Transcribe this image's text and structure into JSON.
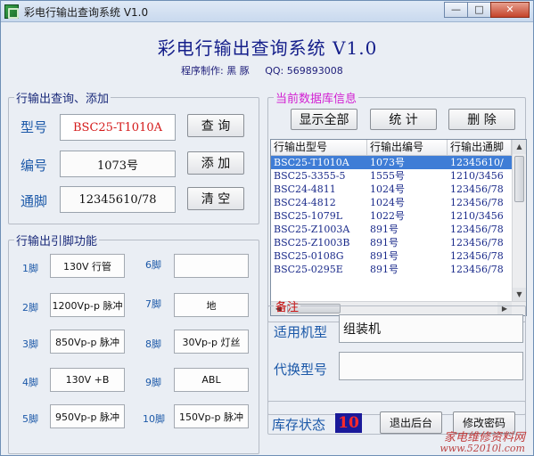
{
  "window": {
    "title": "彩电行输出查询系统 V1.0"
  },
  "header": {
    "title": "彩电行输出查询系统 V1.0",
    "author": "程序制作: 黑 豚",
    "qq": "QQ: 569893008"
  },
  "query": {
    "legend": "行输出查询、添加",
    "model_label": "型号",
    "model_value": "BSC25-T1010A",
    "code_label": "编号",
    "code_value": "1073号",
    "pins_label": "通脚",
    "pins_value": "12345610/78",
    "btn_query": "查 询",
    "btn_add": "添 加",
    "btn_clear": "清 空"
  },
  "pin_functions": {
    "legend": "行输出引脚功能",
    "pins": [
      {
        "label": "1脚",
        "value": "130V 行管"
      },
      {
        "label": "2脚",
        "value": "1200Vp-p 脉冲"
      },
      {
        "label": "3脚",
        "value": "850Vp-p 脉冲"
      },
      {
        "label": "4脚",
        "value": "130V +B"
      },
      {
        "label": "5脚",
        "value": "950Vp-p 脉冲"
      },
      {
        "label": "6脚",
        "value": ""
      },
      {
        "label": "7脚",
        "value": "地"
      },
      {
        "label": "8脚",
        "value": "30Vp-p 灯丝"
      },
      {
        "label": "9脚",
        "value": "ABL"
      },
      {
        "label": "10脚",
        "value": "150Vp-p 脉冲"
      }
    ]
  },
  "database": {
    "legend": "当前数据库信息",
    "btn_show_all": "显示全部",
    "btn_stats": "统  计",
    "btn_delete": "删  除",
    "columns": [
      "行输出型号",
      "行输出编号",
      "行输出通脚"
    ],
    "rows": [
      [
        "BSC25-T1010A",
        "1073号",
        "12345610/"
      ],
      [
        "BSC25-3355-5",
        "1555号",
        "1210/3456"
      ],
      [
        "BSC24-4811",
        "1024号",
        "123456/78"
      ],
      [
        "BSC24-4812",
        "1024号",
        "123456/78"
      ],
      [
        "BSC25-1079L",
        "1022号",
        "1210/3456"
      ],
      [
        "BSC25-Z1003A",
        "891号",
        "123456/78"
      ],
      [
        "BSC25-Z1003B",
        "891号",
        "123456/78"
      ],
      [
        "BSC25-0108G",
        "891号",
        "123456/78"
      ],
      [
        "BSC25-0295E",
        "891号",
        "123456/78"
      ]
    ],
    "selected_row": 0
  },
  "notes": {
    "legend": "备注",
    "applicable_label": "适用机型",
    "applicable_value": "组装机",
    "substitute_label": "代换型号",
    "substitute_value": ""
  },
  "status": {
    "stock_label": "库存状态",
    "stock_value": "10",
    "btn_exit": "退出后台",
    "btn_change_pw": "修改密码"
  },
  "watermark": {
    "text": "家电维修资料网",
    "site": "www.52010l.com"
  }
}
